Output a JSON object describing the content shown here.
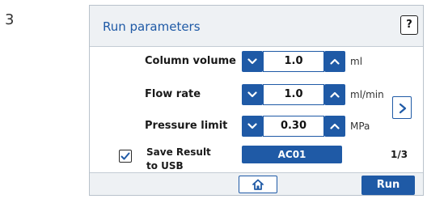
{
  "step_number": "3",
  "header": {
    "title": "Run parameters",
    "help_label": "?"
  },
  "parameters": [
    {
      "label": "Column volume",
      "value": "1.0",
      "unit": "ml"
    },
    {
      "label": "Flow rate",
      "value": "1.0",
      "unit": "ml/min"
    },
    {
      "label": "Pressure limit",
      "value": "0.30",
      "unit": "MPa"
    }
  ],
  "save_result": {
    "label_line1": "Save Result",
    "label_line2": "to USB",
    "checked": true
  },
  "result_name": "AC01",
  "page_indicator": "1/3",
  "footer": {
    "run_label": "Run"
  },
  "icons": {
    "decrement": "chevron-down-icon",
    "increment": "chevron-up-icon",
    "next": "chevron-right-icon",
    "home": "home-icon",
    "checkbox": "checkmark-icon"
  },
  "colors": {
    "accent": "#1f5aa6",
    "panel_header": "#eef1f4",
    "border": "#b9c2cb"
  }
}
